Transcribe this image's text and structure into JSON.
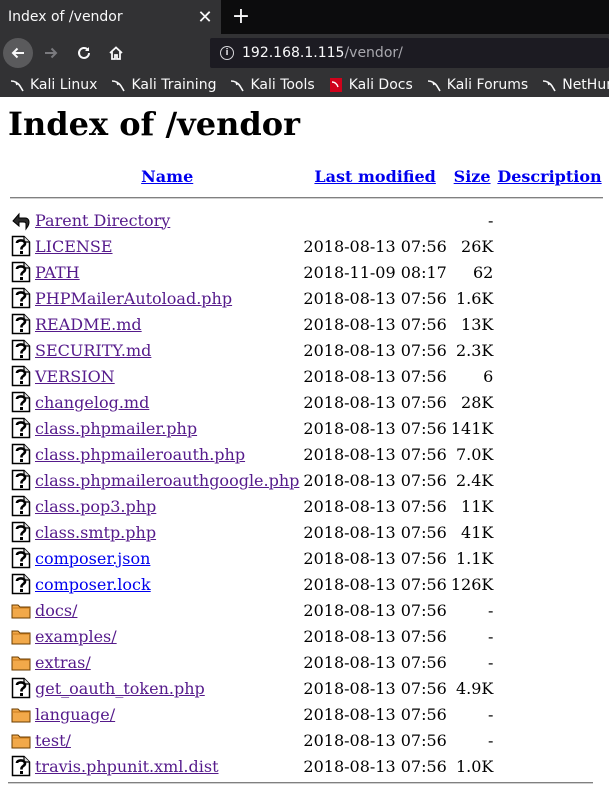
{
  "browser": {
    "tab_title": "Index of /vendor",
    "url_host": "192.168.1.115",
    "url_path": "/vendor/",
    "bookmarks": [
      "Kali Linux",
      "Kali Training",
      "Kali Tools",
      "Kali Docs",
      "Kali Forums",
      "NetHunter"
    ]
  },
  "page": {
    "title": "Index of /vendor",
    "columns": {
      "name": "Name",
      "last_modified": "Last modified",
      "size": "Size",
      "description": "Description"
    },
    "parent": {
      "name": "Parent Directory",
      "size": "-",
      "icon": "back-icon"
    },
    "entries": [
      {
        "name": "LICENSE",
        "date": "2018-08-13 07:56",
        "size": "26K",
        "icon": "unknown-file-icon"
      },
      {
        "name": "PATH",
        "date": "2018-11-09 08:17",
        "size": "62",
        "icon": "unknown-file-icon"
      },
      {
        "name": "PHPMailerAutoload.php",
        "date": "2018-08-13 07:56",
        "size": "1.6K",
        "icon": "unknown-file-icon"
      },
      {
        "name": "README.md",
        "date": "2018-08-13 07:56",
        "size": "13K",
        "icon": "unknown-file-icon"
      },
      {
        "name": "SECURITY.md",
        "date": "2018-08-13 07:56",
        "size": "2.3K",
        "icon": "unknown-file-icon"
      },
      {
        "name": "VERSION",
        "date": "2018-08-13 07:56",
        "size": "6",
        "icon": "unknown-file-icon"
      },
      {
        "name": "changelog.md",
        "date": "2018-08-13 07:56",
        "size": "28K",
        "icon": "unknown-file-icon"
      },
      {
        "name": "class.phpmailer.php",
        "date": "2018-08-13 07:56",
        "size": "141K",
        "icon": "unknown-file-icon"
      },
      {
        "name": "class.phpmaileroauth.php",
        "date": "2018-08-13 07:56",
        "size": "7.0K",
        "icon": "unknown-file-icon"
      },
      {
        "name": "class.phpmaileroauthgoogle.php",
        "date": "2018-08-13 07:56",
        "size": "2.4K",
        "icon": "unknown-file-icon"
      },
      {
        "name": "class.pop3.php",
        "date": "2018-08-13 07:56",
        "size": "11K",
        "icon": "unknown-file-icon"
      },
      {
        "name": "class.smtp.php",
        "date": "2018-08-13 07:56",
        "size": "41K",
        "icon": "unknown-file-icon"
      },
      {
        "name": "composer.json",
        "date": "2018-08-13 07:56",
        "size": "1.1K",
        "icon": "unknown-file-icon"
      },
      {
        "name": "composer.lock",
        "date": "2018-08-13 07:56",
        "size": "126K",
        "icon": "unknown-file-icon"
      },
      {
        "name": "docs/",
        "date": "2018-08-13 07:56",
        "size": "-",
        "icon": "folder-icon"
      },
      {
        "name": "examples/",
        "date": "2018-08-13 07:56",
        "size": "-",
        "icon": "folder-icon"
      },
      {
        "name": "extras/",
        "date": "2018-08-13 07:56",
        "size": "-",
        "icon": "folder-icon"
      },
      {
        "name": "get_oauth_token.php",
        "date": "2018-08-13 07:56",
        "size": "4.9K",
        "icon": "unknown-file-icon"
      },
      {
        "name": "language/",
        "date": "2018-08-13 07:56",
        "size": "-",
        "icon": "folder-icon"
      },
      {
        "name": "test/",
        "date": "2018-08-13 07:56",
        "size": "-",
        "icon": "folder-icon"
      },
      {
        "name": "travis.phpunit.xml.dist",
        "date": "2018-08-13 07:56",
        "size": "1.0K",
        "icon": "unknown-file-icon"
      }
    ],
    "visited_flags": [
      true,
      true,
      true,
      true,
      true,
      true,
      true,
      true,
      true,
      true,
      true,
      true,
      false,
      false,
      true,
      true,
      true,
      true,
      true,
      true,
      true
    ]
  },
  "colors": {
    "visited_link": "#551a8b",
    "unvisited_link": "#0000ee",
    "chrome_dark": "#0c0c0d",
    "toolbar": "#323234"
  }
}
